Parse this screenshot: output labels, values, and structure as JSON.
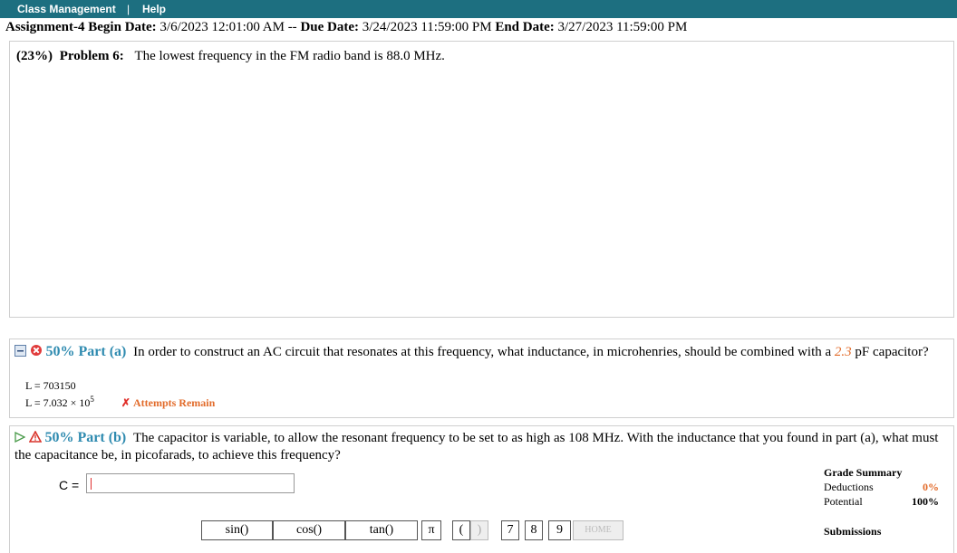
{
  "nav": {
    "class_management": "Class Management",
    "separator": "|",
    "help": "Help"
  },
  "assignment": {
    "title": "Assignment-4",
    "begin_label": "Begin Date:",
    "begin": "3/6/2023 12:01:00 AM",
    "sep": "--",
    "due_label": "Due Date:",
    "due": "3/24/2023 11:59:00 PM",
    "end_label": "End Date:",
    "end": "3/27/2023 11:59:00 PM"
  },
  "problem": {
    "weight": "(23%)",
    "label": "Problem 6:",
    "text": "The lowest frequency in the FM radio band is 88.0 MHz."
  },
  "part_a": {
    "label": "50% Part (a)",
    "text_before": "In order to construct an AC circuit that resonates at this frequency, what inductance, in microhenries, should be combined with a",
    "value": "2.3",
    "text_after": "pF capacitor?",
    "answer_line": "L = 703150",
    "answer_sci_prefix": "L = 7.032 × 10",
    "answer_sci_exp": "5",
    "status": "Attempts Remain",
    "status_mark": "✗"
  },
  "part_b": {
    "label": "50% Part (b)",
    "text": "The capacitor is variable, to allow the resonant frequency to be set to as high as 108 MHz. With the inductance that you found in part (a), what must the capacitance be, in picofarads, to achieve this frequency?",
    "input_label": "C ="
  },
  "grade_summary": {
    "title": "Grade Summary",
    "deductions_label": "Deductions",
    "deductions": "0%",
    "potential_label": "Potential",
    "potential": "100%"
  },
  "submissions": {
    "title": "Submissions"
  },
  "keypad": {
    "sin": "sin()",
    "cos": "cos()",
    "tan": "tan()",
    "pi": "π",
    "lparen": "(",
    "rparen": ")",
    "k7": "7",
    "k8": "8",
    "k9": "9",
    "home": "HOME"
  },
  "colors": {
    "topbar": "#1d6f80",
    "part_label": "#2f8bb0",
    "accent_orange": "#e26b2a",
    "error_red": "#e0302a"
  }
}
